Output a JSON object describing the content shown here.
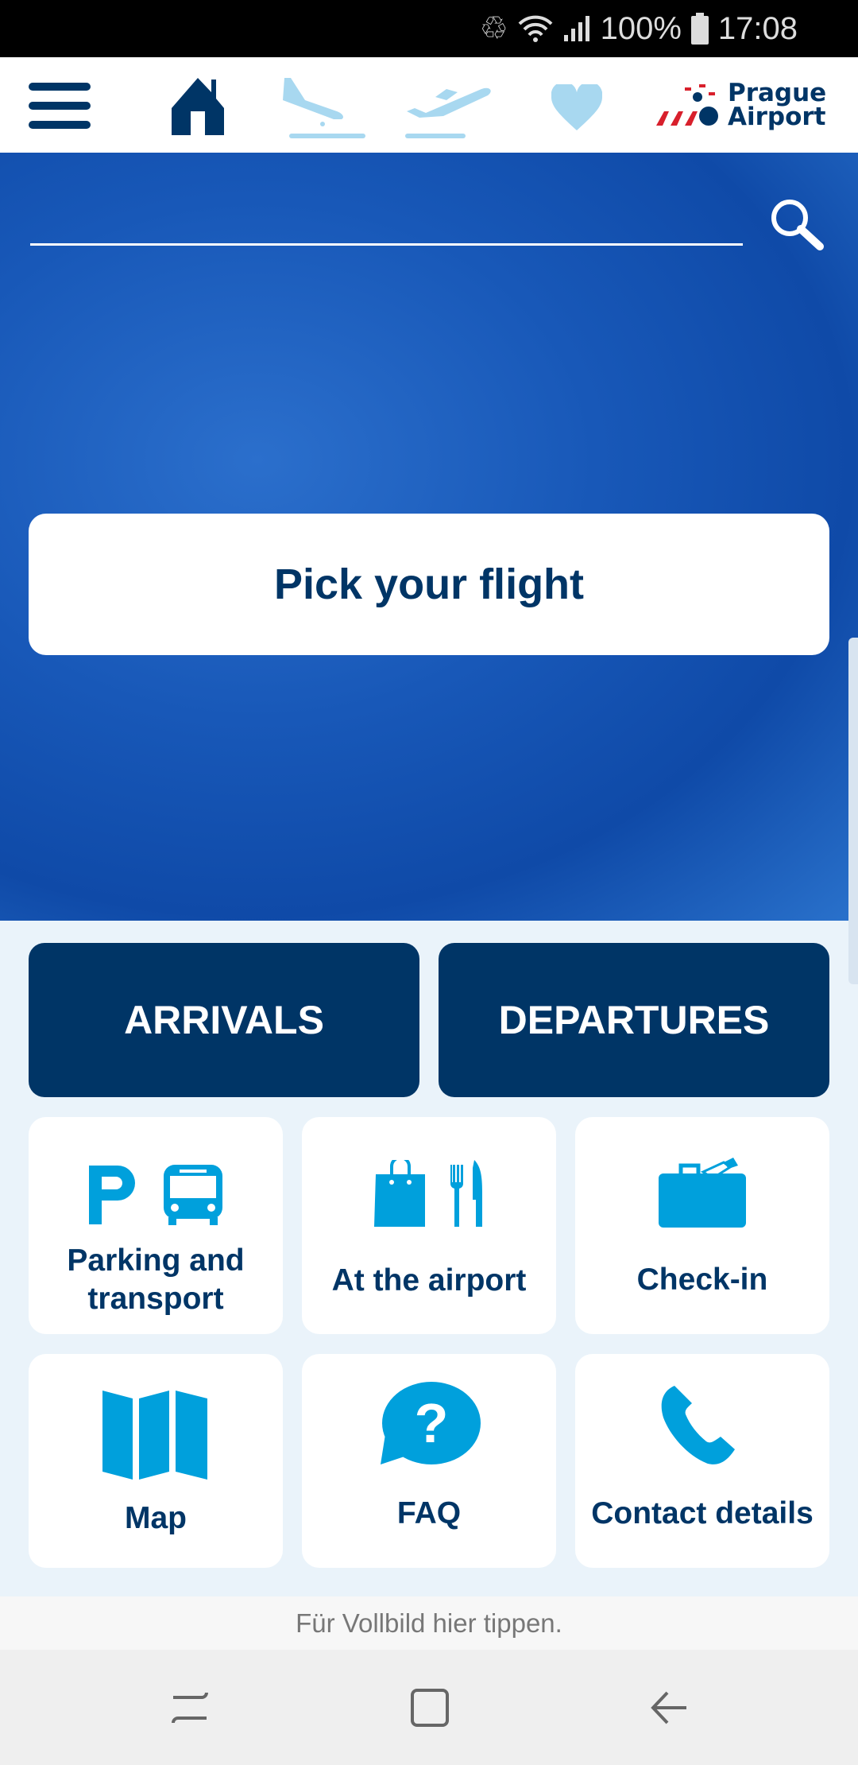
{
  "status_bar": {
    "battery": "100%",
    "time": "17:08"
  },
  "header": {
    "icons": [
      "menu-icon",
      "home-icon",
      "arrivals-icon",
      "departures-icon",
      "favorites-heart-icon"
    ],
    "logo": "Prague Airport"
  },
  "hero": {
    "search_value": "",
    "pick_flight": "Pick your flight"
  },
  "flights": {
    "arrivals": "ARRIVALS",
    "departures": "DEPARTURES"
  },
  "tiles": [
    {
      "label": "Parking and transport",
      "icon": "parking-bus-icon"
    },
    {
      "label": "At the airport",
      "icon": "shopping-dining-icon"
    },
    {
      "label": "Check-in",
      "icon": "suitcase-icon"
    },
    {
      "label": "Map",
      "icon": "map-icon"
    },
    {
      "label": "FAQ",
      "icon": "question-bubble-icon"
    },
    {
      "label": "Contact details",
      "icon": "phone-icon"
    }
  ],
  "fullscreen_hint": "Für Vollbild hier tippen.",
  "colors": {
    "navy": "#003566",
    "accent": "#00a0dc",
    "light_icon": "#a8d8f0",
    "brand_red": "#d8202c"
  }
}
